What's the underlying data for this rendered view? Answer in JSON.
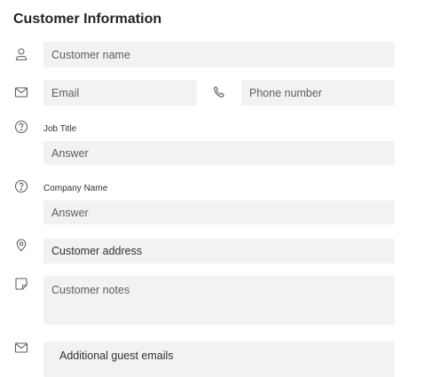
{
  "section": {
    "title": "Customer Information"
  },
  "fields": {
    "customer_name": {
      "placeholder": "Customer name",
      "icon": "person-icon"
    },
    "email": {
      "placeholder": "Email",
      "icon": "mail-icon"
    },
    "phone": {
      "placeholder": "Phone number",
      "icon": "phone-icon"
    },
    "job_title": {
      "label": "Job Title",
      "placeholder": "Answer",
      "icon": "question-icon"
    },
    "company_name": {
      "label": "Company Name",
      "placeholder": "Answer",
      "icon": "question-icon"
    },
    "customer_address": {
      "placeholder": "Customer address",
      "icon": "location-icon"
    },
    "customer_notes": {
      "placeholder": "Customer notes",
      "icon": "note-icon"
    },
    "guest_emails": {
      "placeholder": "Additional guest emails",
      "icon": "mail-icon"
    }
  }
}
